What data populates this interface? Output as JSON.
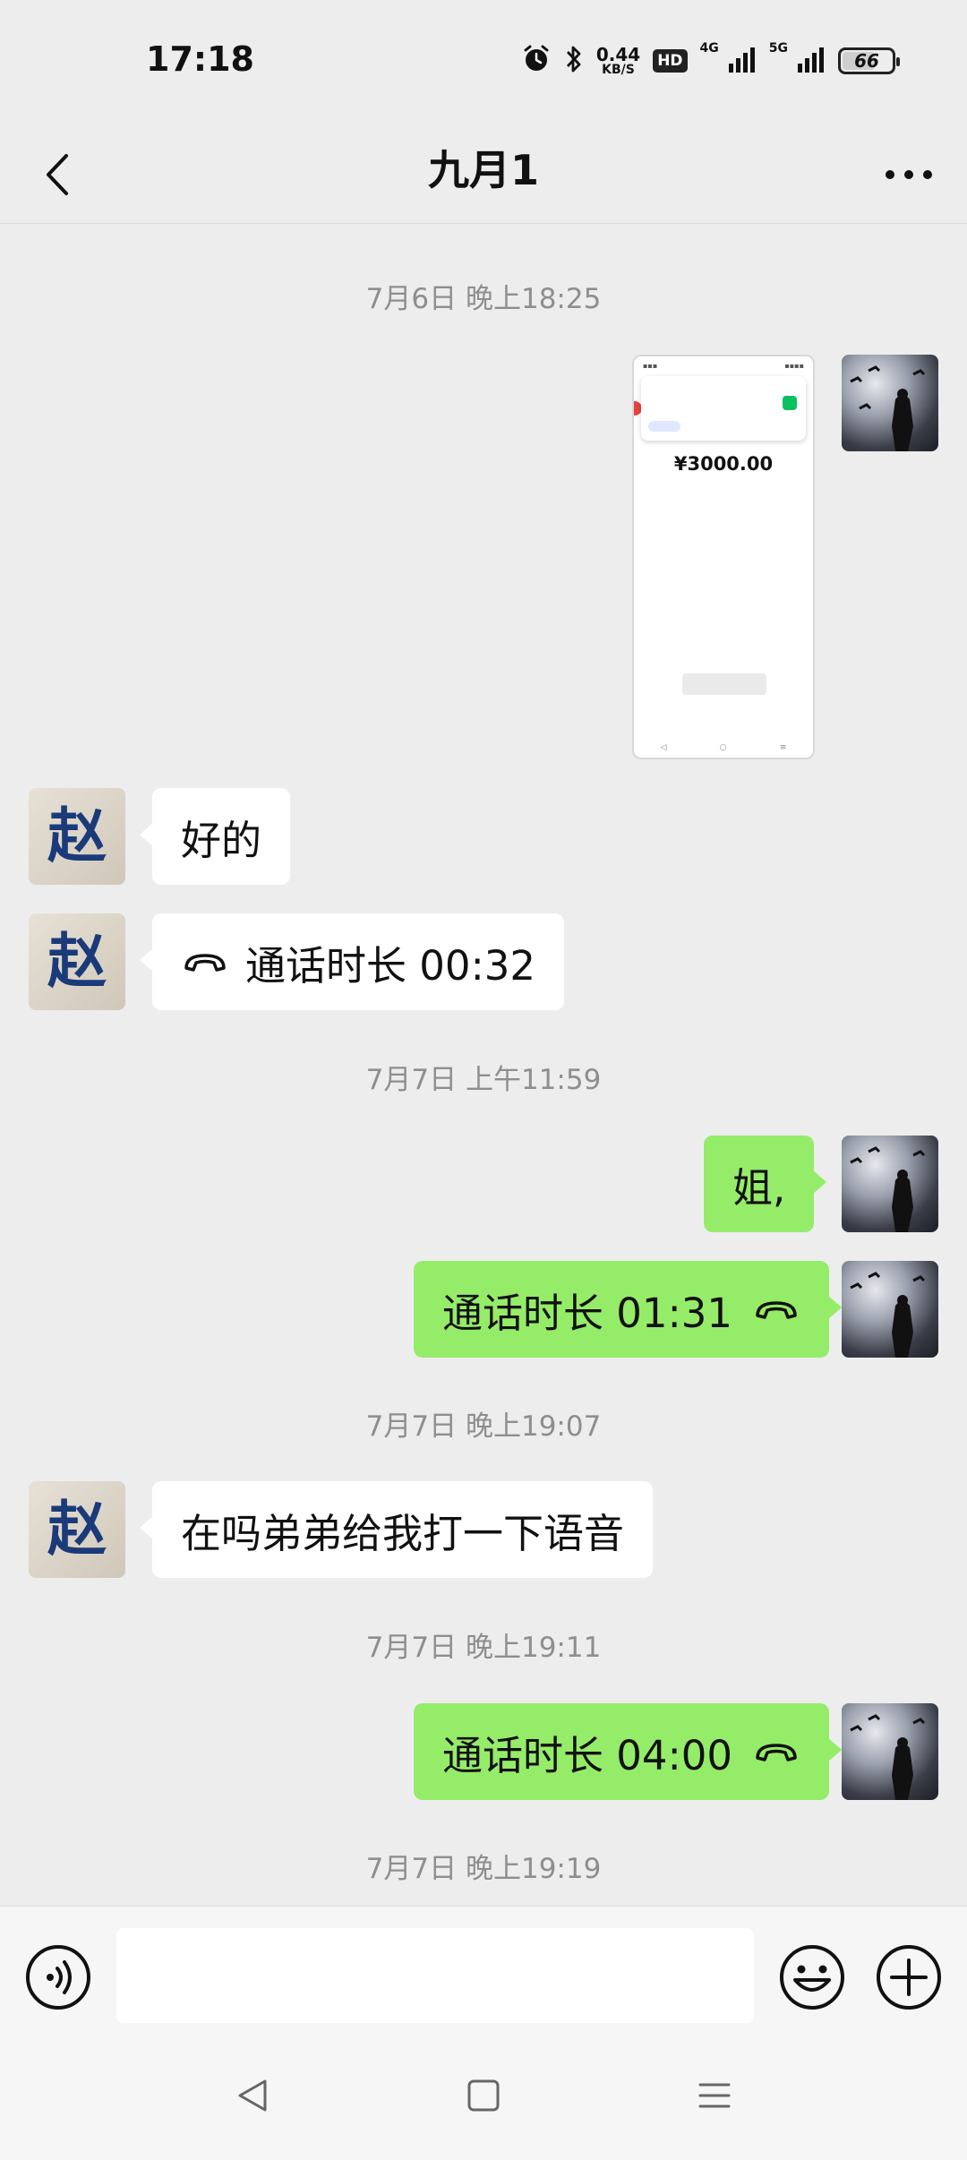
{
  "status_bar": {
    "time": "17:18",
    "net_speed_value": "0.44",
    "net_speed_unit": "KB/S",
    "hd_badge": "HD",
    "signal1_label": "4G",
    "signal2_label": "5G",
    "battery": "66"
  },
  "header": {
    "title": "九月1"
  },
  "messages": {
    "ts1": "7月6日 晚上18:25",
    "image_msg": {
      "amount": "¥3000.00"
    },
    "m1_text": "好的",
    "m2_call": "通话时长 00:32",
    "ts2": "7月7日 上午11:59",
    "m3_text": "姐,",
    "m4_call": "通话时长 01:31",
    "ts3": "7月7日 晚上19:07",
    "m5_text": "在吗弟弟给我打一下语音",
    "ts4": "7月7日 晚上19:11",
    "m6_call": "通话时长 04:00",
    "ts5": "7月7日 晚上19:19"
  },
  "input_bar": {
    "value": ""
  },
  "icons": {
    "back": "chevron-left-icon",
    "more": "more-horizontal-icon",
    "voice": "voice-icon",
    "emoji": "emoji-icon",
    "plus": "plus-icon",
    "call": "phone-hangup-icon"
  },
  "colors": {
    "background": "#ededed",
    "sent_bubble": "#95ec69",
    "received_bubble": "#ffffff",
    "timestamp": "#8e8e8e"
  }
}
